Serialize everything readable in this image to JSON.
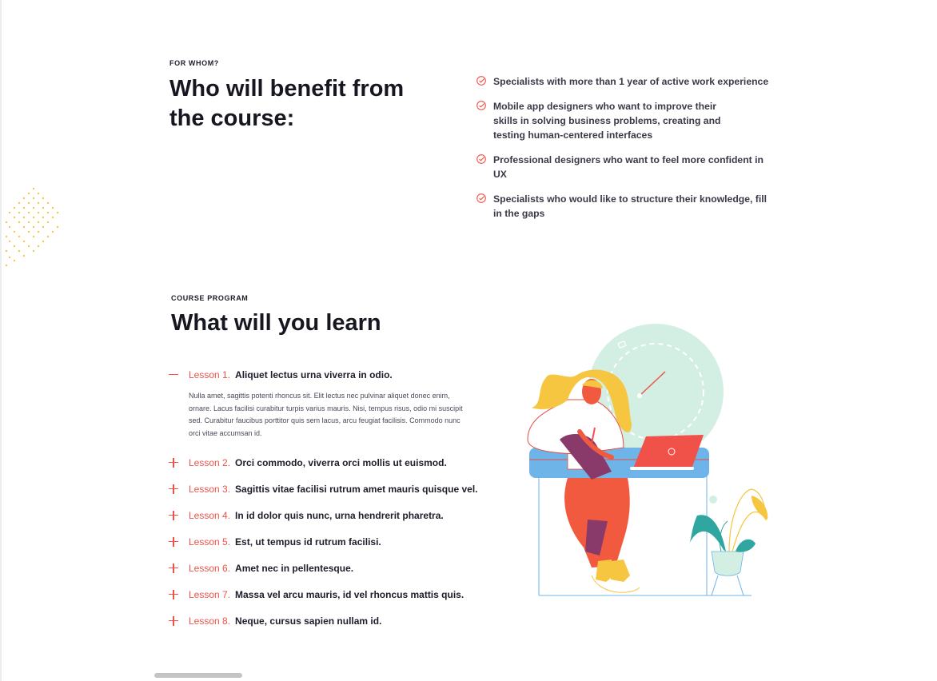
{
  "benefit_section": {
    "eyebrow": "FOR WHOM?",
    "title": "Who will benefit from the course:",
    "items": [
      "Specialists with more than 1 year of active work experience",
      "Mobile app designers who want to improve their skills in solving business problems, creating and testing human-centered interfaces",
      "Professional designers who want to feel more confident in UX",
      "Specialists who would like to structure their knowledge, fill in the gaps"
    ]
  },
  "program_section": {
    "eyebrow": "COURSE PROGRAM",
    "title": "What will you learn",
    "lessons": [
      {
        "number": "Lesson 1.",
        "title": "Aliquet lectus urna viverra in odio.",
        "expanded": true,
        "description": "Nulla amet, sagittis potenti rhoncus sit. Elit lectus nec pulvinar aliquet donec enim, ornare. Lacus facilisi curabitur turpis varius mauris. Nisi, tempus risus, odio mi suscipit sed. Curabitur faucibus porttitor quis sem lacus, arcu feugiat facilisis. Commodo nunc orci vitae accumsan id."
      },
      {
        "number": "Lesson 2.",
        "title": "Orci commodo, viverra orci mollis ut euismod.",
        "expanded": false
      },
      {
        "number": "Lesson 3.",
        "title": "Sagittis vitae facilisi rutrum amet mauris quisque vel.",
        "expanded": false
      },
      {
        "number": "Lesson 4.",
        "title": "In id dolor quis nunc, urna hendrerit pharetra.",
        "expanded": false
      },
      {
        "number": "Lesson 5.",
        "title": "Est, ut tempus id rutrum facilisi.",
        "expanded": false
      },
      {
        "number": "Lesson 6.",
        "title": "Amet nec in pellentesque.",
        "expanded": false
      },
      {
        "number": "Lesson 7.",
        "title": "Massa vel arcu mauris, id vel rhoncus mattis quis.",
        "expanded": false
      },
      {
        "number": "Lesson 8.",
        "title": "Neque, cursus sapien nullam id.",
        "expanded": false
      }
    ]
  },
  "icons": {
    "check": "check-circle-icon",
    "collapse": "minus-icon",
    "expand": "plus-icon"
  },
  "colors": {
    "accent": "#f0524a",
    "dots": "#f5c84b",
    "clock_bg": "#d3efe3",
    "desk": "#6fb4e8",
    "hair": "#f6c640",
    "pants": "#f25a40",
    "laptop": "#f0524a",
    "plant": "#2fa6a0"
  }
}
